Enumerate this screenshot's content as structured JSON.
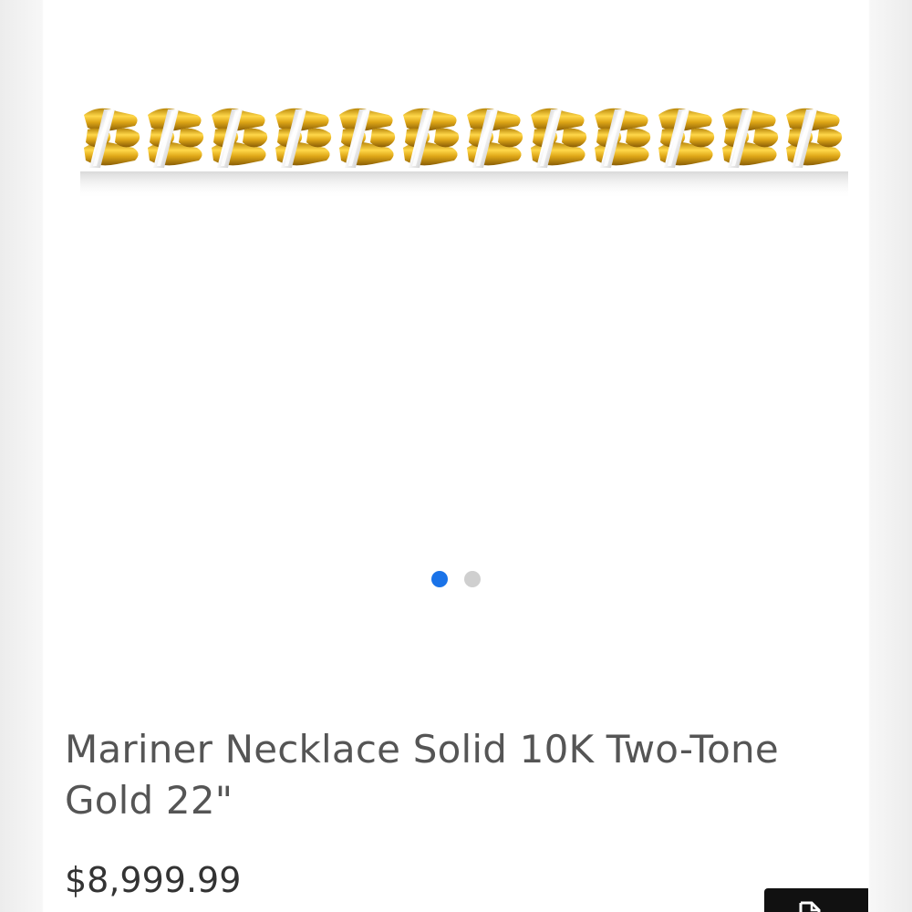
{
  "product": {
    "title": "Mariner Necklace Solid 10K Two-Tone Gold 22\"",
    "price": "$8,999.99",
    "image": {
      "name": "two-tone-mariner-chain-image"
    }
  },
  "gallery": {
    "total_slides": 2,
    "active_slide": 1
  },
  "colors": {
    "active_dot": "#1a73e8",
    "inactive_dot": "#cfcfcf",
    "title_text": "#555555",
    "price_text": "#333333",
    "gold": "#d9a520",
    "white_gold": "#e6e6e6",
    "corner_button": "#111111"
  },
  "icons": {
    "corner_button_icon": "document-icon"
  }
}
